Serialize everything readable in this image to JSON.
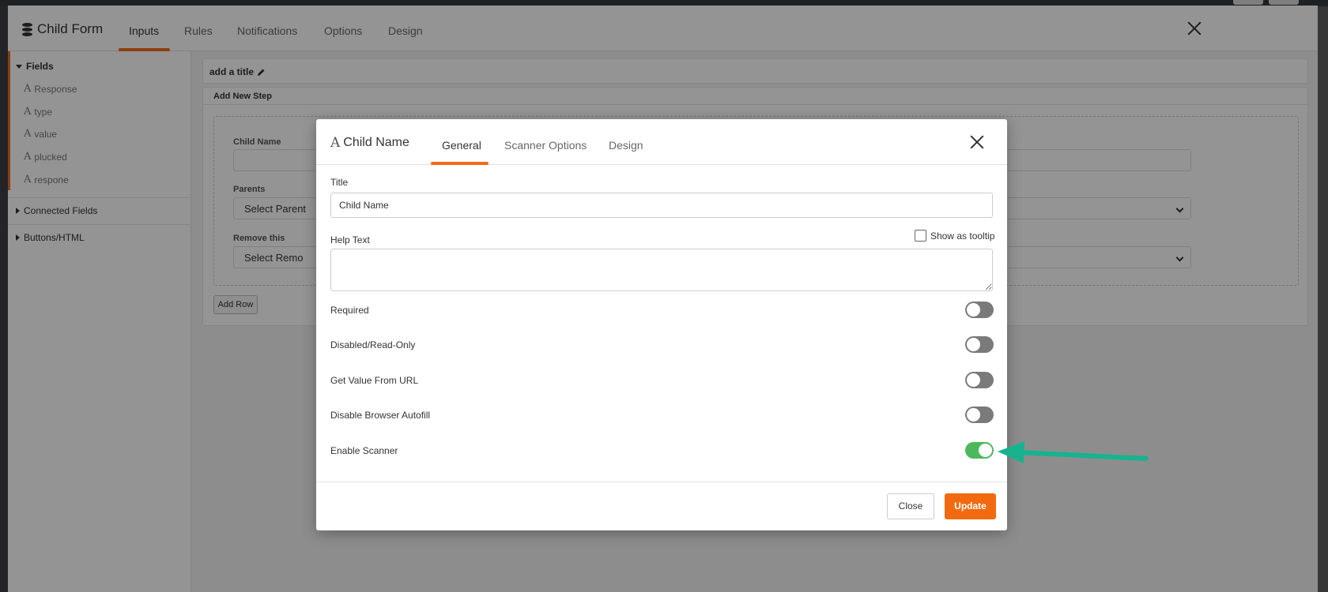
{
  "form": {
    "title": "Child Form",
    "tabs": [
      "Inputs",
      "Rules",
      "Notifications",
      "Options",
      "Design"
    ],
    "active_tab": "Inputs"
  },
  "sidebar": {
    "fields_header": "Fields",
    "fields": [
      "Response",
      "type",
      "value",
      "plucked",
      "respone"
    ],
    "connected_fields": "Connected Fields",
    "buttons_html": "Buttons/HTML"
  },
  "canvas": {
    "title_placeholder": "add a title",
    "step_header": "Add New Step",
    "child_name_label": "Child Name",
    "parents_label": "Parents",
    "parents_select": "Select Parent",
    "remove_label": "Remove this",
    "remove_select": "Select Remo",
    "add_row": "Add Row"
  },
  "modal": {
    "title": "Child Name",
    "tabs": [
      "General",
      "Scanner Options",
      "Design"
    ],
    "active_tab": "General",
    "title_label": "Title",
    "title_value": "Child Name",
    "help_text_label": "Help Text",
    "show_as_tooltip": "Show as tooltip",
    "toggles": [
      {
        "label": "Required",
        "on": false
      },
      {
        "label": "Disabled/Read-Only",
        "on": false
      },
      {
        "label": "Get Value From URL",
        "on": false
      },
      {
        "label": "Disable Browser Autofill",
        "on": false
      },
      {
        "label": "Enable Scanner",
        "on": true
      }
    ],
    "close_button": "Close",
    "update_button": "Update"
  },
  "colors": {
    "accent": "#f26a1b",
    "toggle_on": "#4cb85c",
    "toggle_off": "#7a7a7a",
    "annotation_arrow": "#16b38e"
  }
}
